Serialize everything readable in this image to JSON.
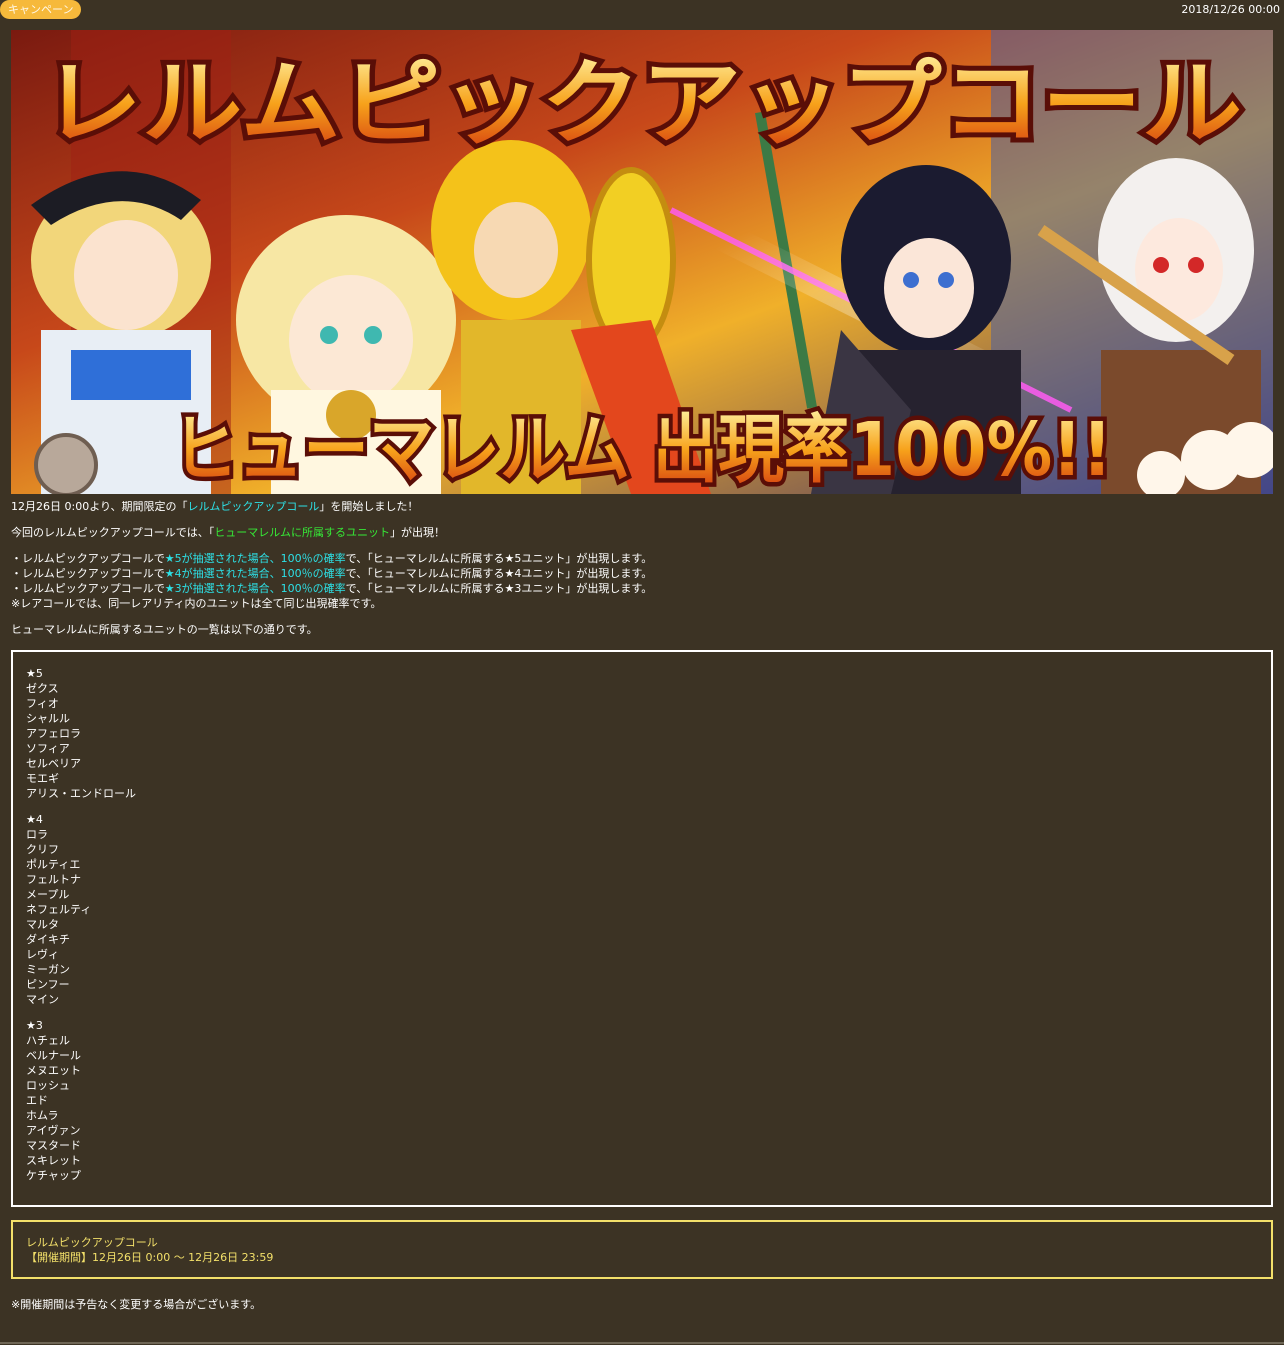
{
  "header": {
    "badge": "キャンペーン",
    "date": "2018/12/26 00:00"
  },
  "banner": {
    "title": "レルムピックアップコール",
    "subtitle": "ヒューマレルム 出現率100%!!"
  },
  "intro": {
    "line1_pre": "12月26日 0:00より、期間限定の「",
    "line1_link": "レルムピックアップコール",
    "line1_post": "」を開始しました！",
    "line2_pre": "今回のレルムピックアップコールでは、「",
    "line2_link": "ヒューマレルムに所属するユニット",
    "line2_post": "」が出現！"
  },
  "rates": [
    {
      "pre": "・レルムピックアップコールで",
      "hl": "★5が抽選された場合、100％の確率",
      "post": "で、「ヒューマレルムに所属する★5ユニット」が出現します。"
    },
    {
      "pre": "・レルムピックアップコールで",
      "hl": "★4が抽選された場合、100％の確率",
      "post": "で、「ヒューマレルムに所属する★4ユニット」が出現します。"
    },
    {
      "pre": "・レルムピックアップコールで",
      "hl": "★3が抽選された場合、100％の確率",
      "post": "で、「ヒューマレルムに所属する★3ユニット」が出現します。"
    }
  ],
  "rate_note": "※レアコールでは、同一レアリティ内のユニットは全て同じ出現確率です。",
  "list_intro": "ヒューマレルムに所属するユニットの一覧は以下の通りです。",
  "unit_groups": [
    {
      "rarity": "★5",
      "units": [
        "ゼクス",
        "フィオ",
        "シャルル",
        "アフェロラ",
        "ソフィア",
        "セルベリア",
        "モエギ",
        "アリス・エンドロール"
      ]
    },
    {
      "rarity": "★4",
      "units": [
        "ロラ",
        "クリフ",
        "ポルティエ",
        "フェルトナ",
        "メープル",
        "ネフェルティ",
        "マルタ",
        "ダイキチ",
        "レヴィ",
        "ミーガン",
        "ピンフー",
        "マイン"
      ]
    },
    {
      "rarity": "★3",
      "units": [
        "ハチェル",
        "ベルナール",
        "メヌエット",
        "ロッシュ",
        "エド",
        "ホムラ",
        "アイヴァン",
        "マスタード",
        "スキレット",
        "ケチャップ"
      ]
    }
  ],
  "event": {
    "name": "レルムピックアップコール",
    "period": "【開催期間】12月26日 0:00 ～ 12月26日 23:59"
  },
  "footnote": "※開催期間は予告なく変更する場合がございます。",
  "colors": {
    "background": "#3c3324",
    "badge": "#f6b93b",
    "link_cyan": "#2de0e6",
    "link_green": "#36e836",
    "event_yellow": "#f3e06a"
  }
}
